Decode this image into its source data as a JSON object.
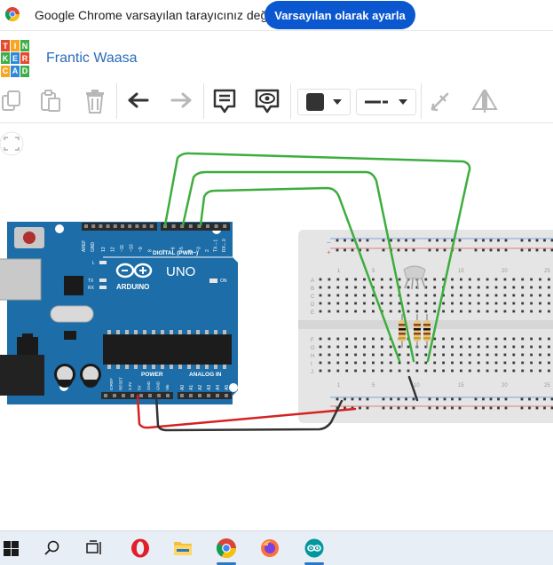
{
  "browser": {
    "default_prompt": "Google Chrome varsayılan tarayıcınız değil",
    "set_default_button": "Varsayılan olarak ayarla"
  },
  "app": {
    "logo_letters": [
      "T",
      "I",
      "N",
      "K",
      "E",
      "R",
      "C",
      "A",
      "D"
    ],
    "logo_colors": [
      "#e64a2e",
      "#f5a623",
      "#3fae49",
      "#3fae49",
      "#2d8ad8",
      "#e64a2e",
      "#f5a623",
      "#2d8ad8",
      "#3fae49"
    ],
    "project_title": "Frantic Waasa"
  },
  "toolbar": {
    "tools": [
      "copy-icon",
      "paste-icon",
      "delete-icon",
      "undo-icon",
      "redo-icon",
      "notes-icon",
      "toggle-notes-icon",
      "color-swatch",
      "line-style",
      "flip-tool-icon",
      "mirror-icon"
    ],
    "color_value": "#333333"
  },
  "arduino": {
    "model": "UNO",
    "brand": "ARDUINO",
    "digital_label": "DIGITAL (PWM~)",
    "analog_label": "ANALOG IN",
    "power_label": "POWER",
    "aref": "AREF",
    "gnd": "GND",
    "pin_labels": [
      "13",
      "12",
      "~11",
      "~10",
      "~9",
      "8",
      "7",
      "~6",
      "~5",
      "4",
      "~3",
      "2",
      "TX→1",
      "RX←0"
    ],
    "power_pins": [
      "IOREF",
      "RESET",
      "3.3V",
      "5V",
      "GND",
      "GND",
      "Vin"
    ],
    "analog_pins": [
      "A0",
      "A1",
      "A2",
      "A3",
      "A4",
      "A5"
    ],
    "led_labels": [
      "L",
      "TX",
      "RX"
    ],
    "on_label": "ON",
    "board_color": "#1d6ea8"
  },
  "breadboard": {
    "row_letters_top": [
      "A",
      "B",
      "C",
      "D",
      "E"
    ],
    "row_letters_bottom": [
      "F",
      "G",
      "H",
      "I",
      "J"
    ],
    "column_numbers": [
      "1",
      "5",
      "10",
      "15",
      "20",
      "25"
    ]
  },
  "wires": {
    "signal_color": "#3dae3d",
    "power_color": "#d42222",
    "ground_color": "#333333"
  },
  "taskbar": {
    "apps": [
      "windows-start",
      "search",
      "task-view",
      "opera",
      "file-explorer",
      "chrome",
      "firefox",
      "arduino-ide"
    ]
  }
}
